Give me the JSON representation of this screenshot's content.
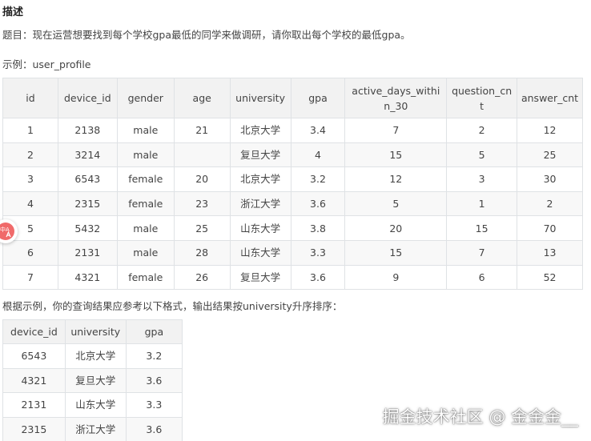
{
  "description": {
    "heading": "描述",
    "question": "题目：现在运营想要找到每个学校gpa最低的同学来做调研，请你取出每个学校的最低gpa。",
    "example_label": "示例：user_profile",
    "result_text": "根据示例，你的查询结果应参考以下格式，输出结果按university升序排序："
  },
  "user_profile": {
    "headers": [
      "id",
      "device_id",
      "gender",
      "age",
      "university",
      "gpa",
      "active_days_within_30",
      "question_cnt",
      "answer_cnt"
    ],
    "rows": [
      [
        "1",
        "2138",
        "male",
        "21",
        "北京大学",
        "3.4",
        "7",
        "2",
        "12"
      ],
      [
        "2",
        "3214",
        "male",
        "",
        "复旦大学",
        "4",
        "15",
        "5",
        "25"
      ],
      [
        "3",
        "6543",
        "female",
        "20",
        "北京大学",
        "3.2",
        "12",
        "3",
        "30"
      ],
      [
        "4",
        "2315",
        "female",
        "23",
        "浙江大学",
        "3.6",
        "5",
        "1",
        "2"
      ],
      [
        "5",
        "5432",
        "male",
        "25",
        "山东大学",
        "3.8",
        "20",
        "15",
        "70"
      ],
      [
        "6",
        "2131",
        "male",
        "28",
        "山东大学",
        "3.3",
        "15",
        "7",
        "13"
      ],
      [
        "7",
        "4321",
        "female",
        "26",
        "复旦大学",
        "3.6",
        "9",
        "6",
        "52"
      ]
    ]
  },
  "result_table": {
    "headers": [
      "device_id",
      "university",
      "gpa"
    ],
    "rows": [
      [
        "6543",
        "北京大学",
        "3.2"
      ],
      [
        "4321",
        "复旦大学",
        "3.6"
      ],
      [
        "2131",
        "山东大学",
        "3.3"
      ],
      [
        "2315",
        "浙江大学",
        "3.6"
      ]
    ]
  },
  "translate_button": {
    "icon": "translate-icon",
    "glyph": "中A",
    "color": "#f06a6a"
  },
  "watermark": "掘金技术社区 @ 金金金__"
}
